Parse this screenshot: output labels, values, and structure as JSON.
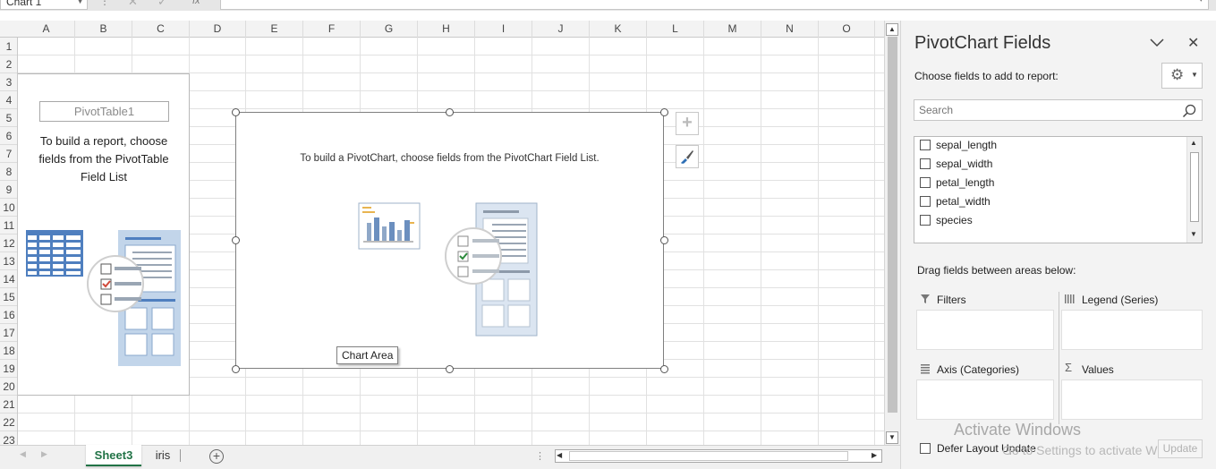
{
  "formula_bar": {
    "name_box": "Chart 1",
    "fx_label": "fx",
    "formula_value": ""
  },
  "grid": {
    "columns": [
      "A",
      "B",
      "C",
      "D",
      "E",
      "F",
      "G",
      "H",
      "I",
      "J",
      "K",
      "L",
      "M",
      "N",
      "O"
    ],
    "rows": [
      "1",
      "2",
      "3",
      "4",
      "5",
      "6",
      "7",
      "8",
      "9",
      "10",
      "11",
      "12",
      "13",
      "14",
      "15",
      "16",
      "17",
      "18",
      "19",
      "20",
      "21",
      "22",
      "23"
    ]
  },
  "pivot_table": {
    "name": "PivotTable1",
    "message": "To build a report, choose fields from the PivotTable Field List"
  },
  "pivot_chart": {
    "message": "To build a PivotChart, choose fields from the PivotChart Field List.",
    "tooltip": "Chart Area",
    "add_element_icon": "plus-icon",
    "style_icon": "paintbrush-icon"
  },
  "sheet_tabs": {
    "tabs": [
      "Sheet3",
      "iris"
    ],
    "active": "Sheet3",
    "add_icon": "plus-circle-icon"
  },
  "pane": {
    "title": "PivotChart Fields",
    "choose_label": "Choose fields to add to report:",
    "search_placeholder": "Search",
    "fields": [
      {
        "name": "sepal_length",
        "checked": false
      },
      {
        "name": "sepal_width",
        "checked": false
      },
      {
        "name": "petal_length",
        "checked": false
      },
      {
        "name": "petal_width",
        "checked": false
      },
      {
        "name": "species",
        "checked": false
      }
    ],
    "drag_label": "Drag fields between areas below:",
    "areas": {
      "filters": "Filters",
      "legend": "Legend (Series)",
      "axis": "Axis (Categories)",
      "values": "Values"
    },
    "defer_label": "Defer Layout Update",
    "update_button": "Update",
    "watermark_title": "Activate Windows",
    "watermark_sub": "Go to Settings to activate Windows."
  },
  "colors": {
    "excel_green": "#217346",
    "pivot_blue": "#4f7fbf"
  }
}
